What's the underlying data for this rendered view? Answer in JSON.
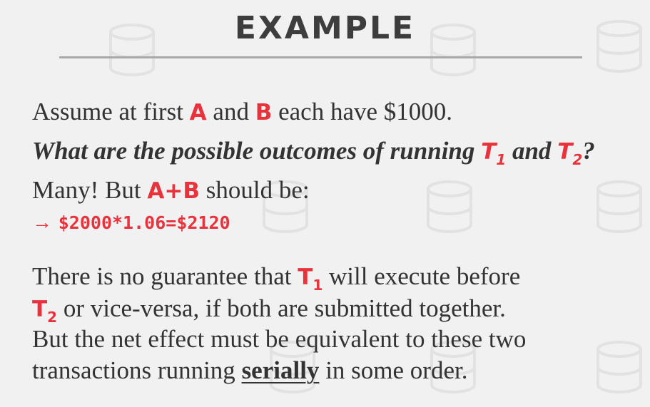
{
  "title": "EXAMPLE",
  "line1": {
    "pre": "Assume at first",
    "var_a": "A",
    "mid": "and",
    "var_b": "B",
    "post": "each have $1000."
  },
  "line2": {
    "pre": "What are the possible outcomes of running",
    "t": "T",
    "t1_sub": "1",
    "and": "and",
    "t2_sub": "2",
    "post": "?"
  },
  "line3": {
    "pre": "Many! But",
    "var": "A+B",
    "post": "should be:"
  },
  "line4": {
    "arrow": "→",
    "formula": "$2000*1.06=$2120"
  },
  "para": {
    "l1_pre": "There is no guarantee that",
    "t": "T",
    "t1_sub": "1",
    "l1_post": "will execute before",
    "t2_sub": "2",
    "l2_post": "or vice-versa, if both are submitted together.",
    "l3": "But the net effect must be equivalent to these two",
    "l4_pre": "transactions running",
    "l4_emph": "serially",
    "l4_post": "in some order."
  },
  "colors": {
    "accent": "#e8323c",
    "text": "#333333",
    "background": "#f1f1f1"
  },
  "background_icon": "database-cylinder-icon"
}
